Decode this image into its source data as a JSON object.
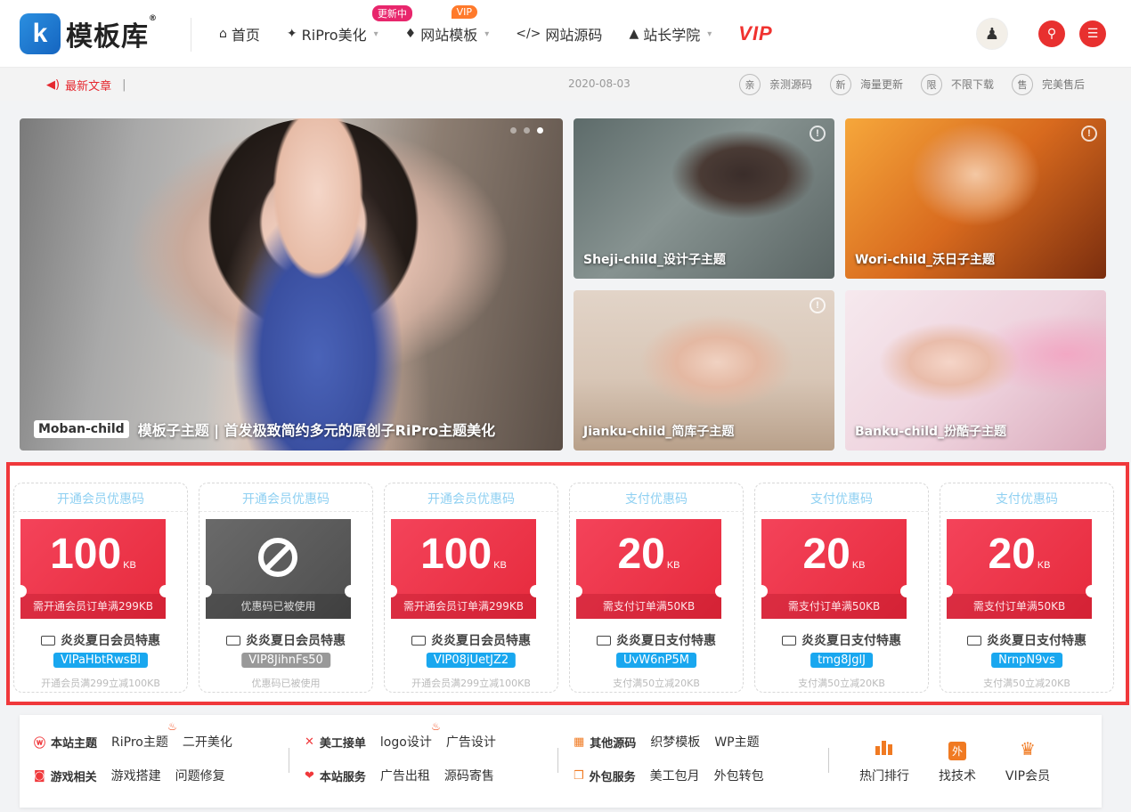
{
  "header": {
    "logo_mark": "k",
    "logo_text": "模板库",
    "logo_reg": "®",
    "nav": [
      {
        "label": "首页",
        "icon": "home-icon",
        "glyph": "⌂"
      },
      {
        "label": "RiPro美化",
        "icon": "rocket-icon",
        "glyph": "✦",
        "badge": "更新中"
      },
      {
        "label": "网站模板",
        "icon": "flame-icon",
        "glyph": "♦",
        "badge": "VIP"
      },
      {
        "label": "网站源码",
        "icon": "code-icon",
        "glyph": "</>"
      },
      {
        "label": "站长学院",
        "icon": "graduation-cap-icon",
        "glyph": "▲"
      }
    ],
    "vip_label": "VIP"
  },
  "notice": {
    "label": "最新文章",
    "separator": "|",
    "date": "2020-08-03",
    "features": [
      {
        "badge": "亲",
        "label": "亲测源码"
      },
      {
        "badge": "新",
        "label": "海量更新"
      },
      {
        "badge": "限",
        "label": "不限下载"
      },
      {
        "badge": "售",
        "label": "完美售后"
      }
    ]
  },
  "slider": {
    "tag": "Moban-child",
    "caption": "模板子主题 | 首发极致简约多元的原创子RiPro主题美化",
    "slide_count": 3,
    "active_slide": 3
  },
  "cards": [
    {
      "caption": "Sheji-child_设计子主题"
    },
    {
      "caption": "Wori-child_沃日子主题"
    },
    {
      "caption": "Jianku-child_简库子主题"
    },
    {
      "caption": "Banku-child_扮酷子主题"
    }
  ],
  "coupons": [
    {
      "title": "开通会员优惠码",
      "amount": "100",
      "unit": "KB",
      "condition": "需开通会员订单满299KB",
      "name": "炎炎夏日会员特惠",
      "code": "VIPaHbtRwsBl",
      "desc": "开通会员满299立减100KB",
      "used": false
    },
    {
      "title": "开通会员优惠码",
      "amount": "",
      "unit": "",
      "condition": "优惠码已被使用",
      "name": "炎炎夏日会员特惠",
      "code": "VIP8JihnFs50",
      "desc": "优惠码已被使用",
      "used": true
    },
    {
      "title": "开通会员优惠码",
      "amount": "100",
      "unit": "KB",
      "condition": "需开通会员订单满299KB",
      "name": "炎炎夏日会员特惠",
      "code": "VIP08jUetJZ2",
      "desc": "开通会员满299立减100KB",
      "used": false
    },
    {
      "title": "支付优惠码",
      "amount": "20",
      "unit": "KB",
      "condition": "需支付订单满50KB",
      "name": "炎炎夏日支付特惠",
      "code": "UvW6nP5M",
      "desc": "支付满50立减20KB",
      "used": false
    },
    {
      "title": "支付优惠码",
      "amount": "20",
      "unit": "KB",
      "condition": "需支付订单满50KB",
      "name": "炎炎夏日支付特惠",
      "code": "tmg8JglJ",
      "desc": "支付满50立减20KB",
      "used": false
    },
    {
      "title": "支付优惠码",
      "amount": "20",
      "unit": "KB",
      "condition": "需支付订单满50KB",
      "name": "炎炎夏日支付特惠",
      "code": "NrnpN9vs",
      "desc": "支付满50立减20KB",
      "used": false
    }
  ],
  "quick": {
    "g1": {
      "row1": {
        "head": "本站主题",
        "links": [
          "RiPro主题",
          "二开美化"
        ]
      },
      "row2": {
        "head": "游戏相关",
        "links": [
          "游戏搭建",
          "问题修复"
        ]
      }
    },
    "g2": {
      "row1": {
        "head": "美工接单",
        "links": [
          "logo设计",
          "广告设计"
        ]
      },
      "row2": {
        "head": "本站服务",
        "links": [
          "广告出租",
          "源码寄售"
        ]
      }
    },
    "g3": {
      "row1": {
        "head": "其他源码",
        "links": [
          "织梦模板",
          "WP主题"
        ]
      },
      "row2": {
        "head": "外包服务",
        "links": [
          "美工包月",
          "外包转包"
        ]
      }
    },
    "icons": [
      {
        "label": "热门排行",
        "icon": "bar-chart-icon"
      },
      {
        "label": "找技术",
        "icon": "outsource-icon",
        "glyph": "外"
      },
      {
        "label": "VIP会员",
        "icon": "crown-icon",
        "glyph": "♛"
      }
    ]
  }
}
